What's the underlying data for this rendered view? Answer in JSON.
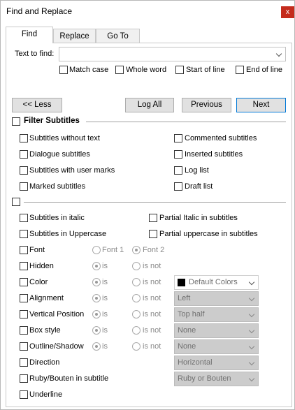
{
  "window": {
    "title": "Find and Replace",
    "close": "x"
  },
  "tabs": [
    "Find",
    "Replace",
    "Go To"
  ],
  "find": {
    "label": "Text to find:",
    "value": "",
    "options": [
      "Match case",
      "Whole word",
      "Start of line",
      "End of line"
    ]
  },
  "buttons": {
    "less": "<< Less",
    "log_all": "Log All",
    "previous": "Previous",
    "next": "Next"
  },
  "filter": {
    "title": "Filter Subtitles",
    "left": [
      "Subtitles without text",
      "Dialogue subtitles",
      "Subtitles with user marks",
      "Marked subtitles"
    ],
    "right": [
      "Commented subtitles",
      "Inserted subtitles",
      "Log list",
      "Draft list"
    ]
  },
  "format": {
    "italic": "Subtitles in italic",
    "partial_italic": "Partial Italic in subtitles",
    "uppercase": "Subtitles in Uppercase",
    "partial_uppercase": "Partial uppercase in subtitles",
    "font": "Font",
    "font1": "Font 1",
    "font2": "Font 2",
    "is": "is",
    "is_not": "is not",
    "rows": [
      {
        "label": "Hidden",
        "combo": ""
      },
      {
        "label": "Color",
        "combo": "Default Colors"
      },
      {
        "label": "Alignment",
        "combo": "Left"
      },
      {
        "label": "Vertical Position",
        "combo": "Top half"
      },
      {
        "label": "Box style",
        "combo": "None"
      },
      {
        "label": "Outline/Shadow",
        "combo": "None"
      }
    ],
    "direction": {
      "label": "Direction",
      "combo": "Horizontal"
    },
    "ruby": {
      "label": "Ruby/Bouten in subtitle",
      "combo": "Ruby or Bouten"
    },
    "underline": "Underline"
  }
}
